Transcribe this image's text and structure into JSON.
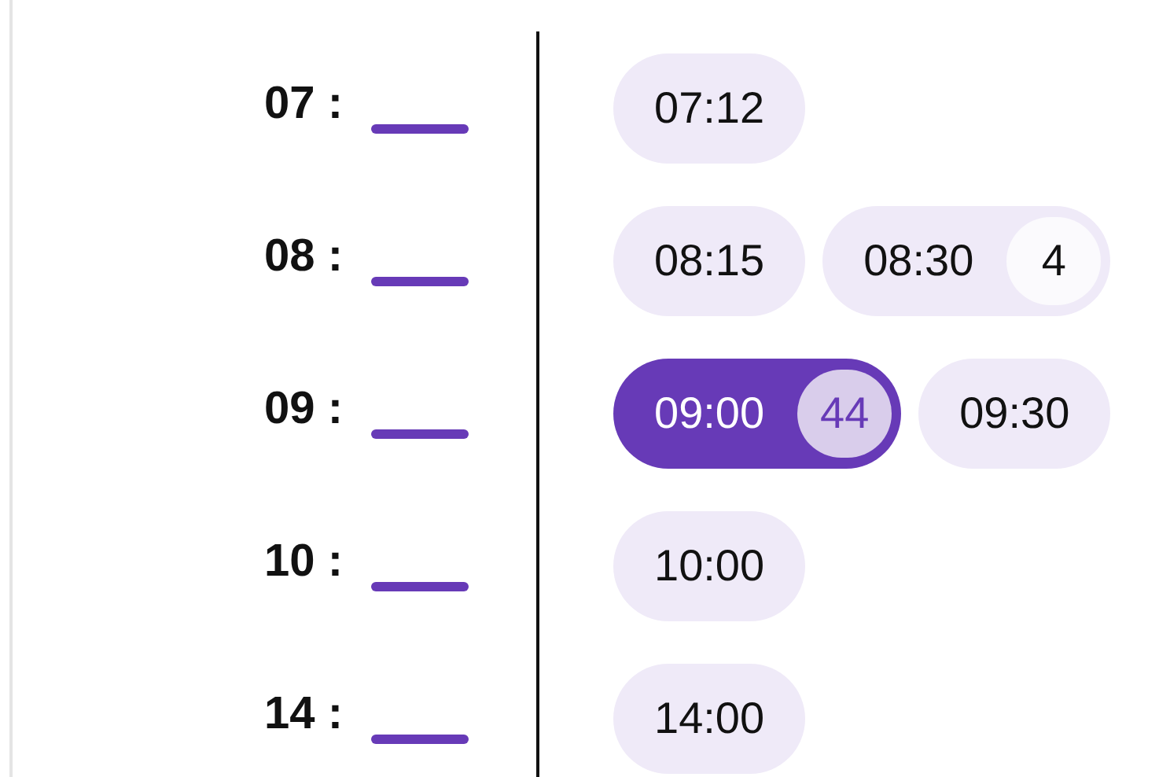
{
  "rows": [
    {
      "hour": "07 :",
      "slots": [
        {
          "time": "07:12",
          "selected": false
        }
      ]
    },
    {
      "hour": "08 :",
      "slots": [
        {
          "time": "08:15",
          "selected": false
        },
        {
          "time": "08:30",
          "count": "4",
          "selected": false
        }
      ]
    },
    {
      "hour": "09 :",
      "slots": [
        {
          "time": "09:00",
          "count": "44",
          "selected": true
        },
        {
          "time": "09:30",
          "selected": false
        }
      ]
    },
    {
      "hour": "10 :",
      "slots": [
        {
          "time": "10:00",
          "selected": false
        }
      ]
    },
    {
      "hour": "14 :",
      "slots": [
        {
          "time": "14:00",
          "selected": false
        }
      ]
    }
  ]
}
